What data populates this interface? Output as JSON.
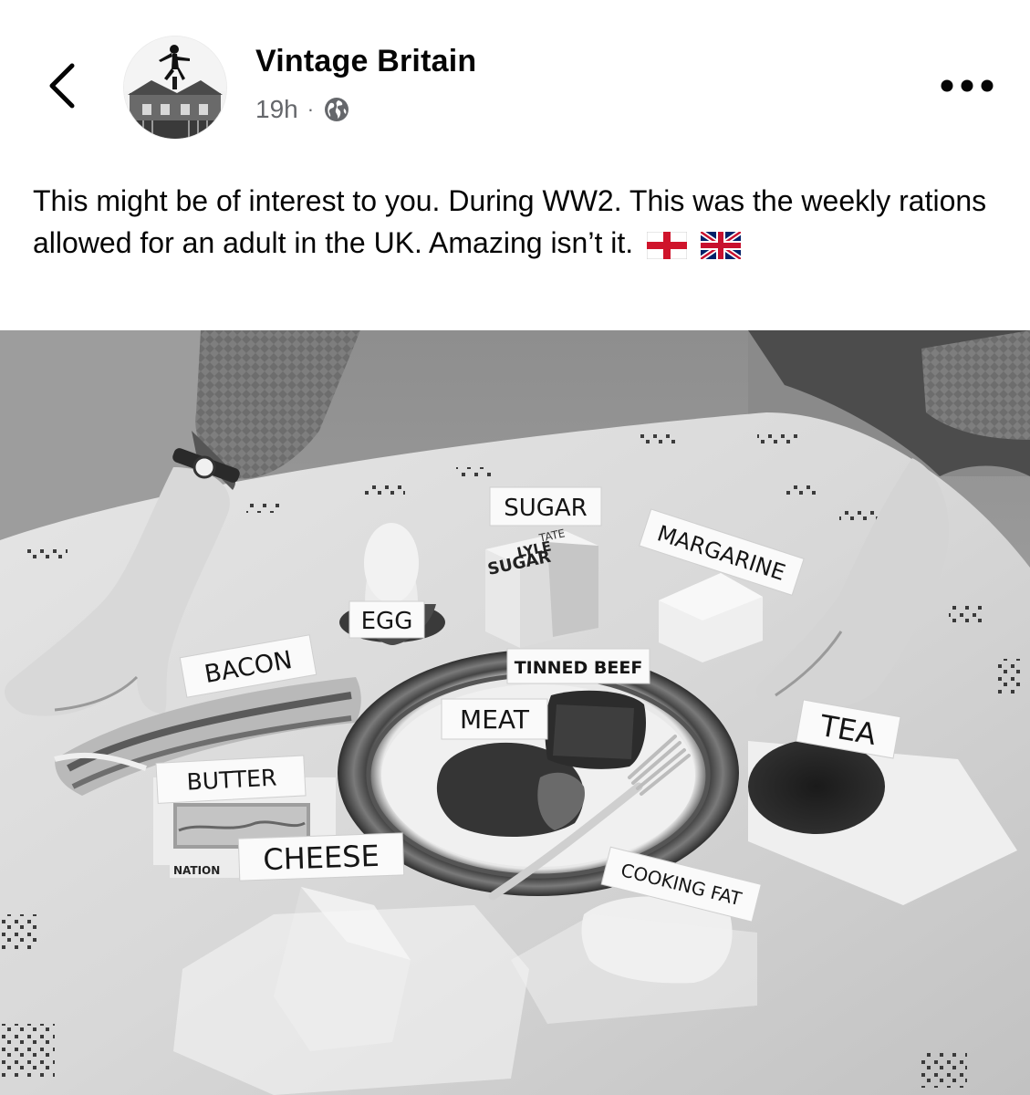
{
  "post": {
    "page_name": "Vintage Britain",
    "time": "19h",
    "separator": "·",
    "audience_icon": "globe-icon",
    "caption": "This might be of interest to you. During WW2. This was the weekly rations allowed for an adult in the UK. Amazing isn’t it.",
    "caption_flags": [
      "england-flag",
      "uk-flag"
    ]
  },
  "nav": {
    "back_icon": "chevron-left-icon",
    "more_icon": "more-options-icon"
  },
  "photo": {
    "labels": {
      "sugar": "SUGAR",
      "margarine": "MARGARINE",
      "egg": "EGG",
      "bacon": "BACON",
      "tinned_beef": "TINNED BEEF",
      "meat": "MEAT",
      "tea": "TEA",
      "butter": "BUTTER",
      "cheese": "CHEESE",
      "cooking_fat": "COOKING FAT"
    },
    "sugar_packet": {
      "line1": "TATE",
      "line2": "LYLE",
      "line3": "SUGAR"
    },
    "butter_wrapper": "NATION"
  }
}
